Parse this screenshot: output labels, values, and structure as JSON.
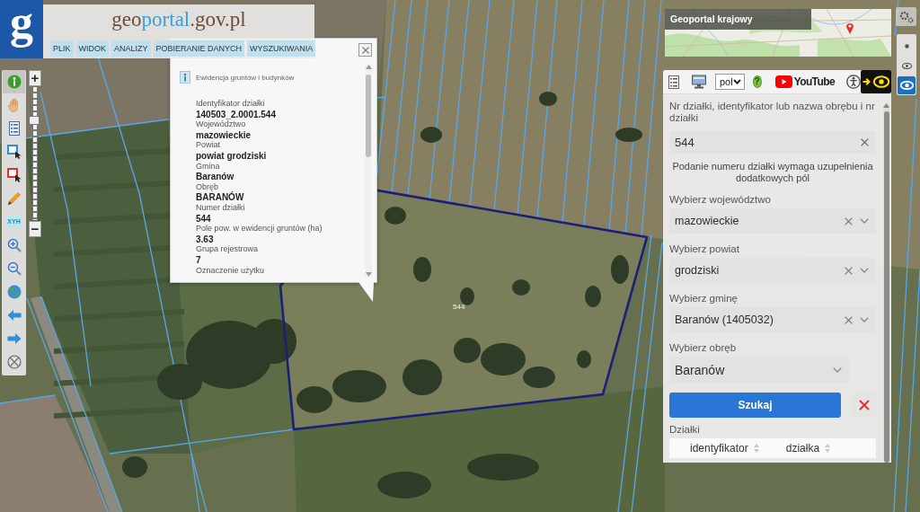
{
  "header": {
    "logo_mark": "g",
    "title_parts": [
      "geo",
      "portal",
      ".gov.pl"
    ],
    "menu": [
      "PLIK",
      "WIDOK",
      "ANALIZY",
      "POBIERANIE DANYCH",
      "WYSZUKIWANIA"
    ]
  },
  "toolbar": {
    "tools": [
      {
        "kind": "info",
        "selected": true
      },
      {
        "kind": "pan",
        "selected": false
      },
      {
        "kind": "legend",
        "selected": false
      },
      {
        "kind": "select-area",
        "selected": false
      },
      {
        "kind": "select-object",
        "selected": false
      },
      {
        "kind": "draw",
        "selected": false
      },
      {
        "kind": "coordinates",
        "label": "XYH",
        "selected": false
      },
      {
        "kind": "zoom-in",
        "selected": false
      },
      {
        "kind": "zoom-out",
        "selected": false
      },
      {
        "kind": "globe",
        "selected": false
      },
      {
        "kind": "back",
        "selected": false
      },
      {
        "kind": "forward",
        "selected": false
      },
      {
        "kind": "reset",
        "selected": false
      }
    ]
  },
  "zoom": {
    "in_label": "+",
    "out_label": "−",
    "level": 0.77
  },
  "popup": {
    "title": "Ewidencja gruntów i budynków",
    "fields": [
      {
        "label": "Identyfikator działki",
        "value": "140503_2.0001.544"
      },
      {
        "label": "Województwo",
        "value": "mazowieckie"
      },
      {
        "label": "Powiat",
        "value": "powiat grodziski"
      },
      {
        "label": "Gmina",
        "value": "Baranów"
      },
      {
        "label": "Obręb",
        "value": "BARANÓW"
      },
      {
        "label": "Numer działki",
        "value": "544"
      },
      {
        "label": "Pole pow. w ewidencji gruntów (ha)",
        "value": "3.63"
      },
      {
        "label": "Grupa rejestrowa",
        "value": "7"
      },
      {
        "label": "Oznaczenie użytku"
      }
    ]
  },
  "map": {
    "parcel_label": "544"
  },
  "overview_map": {
    "title": "Geoportal krajowy"
  },
  "view_buttons": [
    {
      "kind": "small",
      "selected": false
    },
    {
      "kind": "medium",
      "selected": false
    },
    {
      "kind": "large",
      "selected": true
    }
  ],
  "search_panel": {
    "toolbar": {
      "language": "pol",
      "help_label": "?",
      "video_link": "YouTube"
    },
    "query": {
      "label": "Nr działki, identyfikator lub nazwa obrębu i nr działki",
      "value": "544"
    },
    "hint": "Podanie numeru działki wymaga uzupełnienia dodatkowych pól",
    "selects": [
      {
        "label": "Wybierz województwo",
        "value": "mazowieckie",
        "clearable": true
      },
      {
        "label": "Wybierz powiat",
        "value": "grodziski",
        "clearable": true
      },
      {
        "label": "Wybierz gminę",
        "value": "Baranów (1405032)",
        "clearable": true
      },
      {
        "label": "Wybierz obręb",
        "value": "Baranów",
        "clearable": false
      }
    ],
    "search_button": "Szukaj",
    "results": {
      "title": "Działki",
      "columns": [
        "identyfikator",
        "działka"
      ]
    }
  }
}
